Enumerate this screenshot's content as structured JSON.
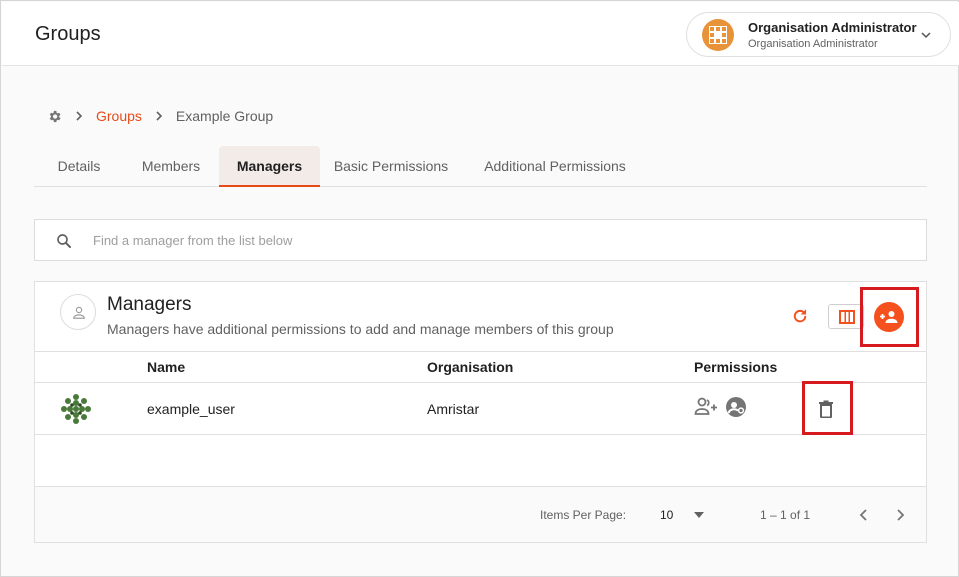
{
  "header": {
    "title": "Groups",
    "user": {
      "name": "Organisation Administrator",
      "role": "Organisation Administrator"
    }
  },
  "breadcrumb": {
    "link": "Groups",
    "current": "Example Group"
  },
  "tabs": [
    {
      "label": "Details",
      "active": false
    },
    {
      "label": "Members",
      "active": false
    },
    {
      "label": "Managers",
      "active": true
    },
    {
      "label": "Basic Permissions",
      "active": false
    },
    {
      "label": "Additional Permissions",
      "active": false
    }
  ],
  "search": {
    "placeholder": "Find a manager from the list below",
    "value": ""
  },
  "card": {
    "title": "Managers",
    "subtitle": "Managers have additional permissions to add and manage members of this group"
  },
  "table": {
    "columns": {
      "name": "Name",
      "organisation": "Organisation",
      "permissions": "Permissions"
    },
    "rows": [
      {
        "name": "example_user",
        "organisation": "Amristar",
        "permission_icons": [
          "add-member-icon",
          "manage-permissions-icon"
        ]
      }
    ]
  },
  "pagination": {
    "items_per_page_label": "Items Per Page:",
    "items_per_page": "10",
    "range": "1 – 1 of 1"
  },
  "colors": {
    "accent": "#e64a19",
    "highlight": "#d71920",
    "tab_active_bg": "#f3ebe8"
  },
  "icons": {
    "header": [
      "org-logo-icon",
      "chevron-down-icon"
    ],
    "breadcrumb": [
      "gear-icon",
      "chevron-right-icon"
    ],
    "search": "search-icon",
    "card": [
      "person-outline-icon",
      "refresh-icon",
      "columns-icon",
      "add-person-icon"
    ],
    "row": [
      "user-avatar-icon",
      "delete-icon"
    ],
    "pagination": [
      "caret-down-icon",
      "chevron-left-icon",
      "chevron-right-icon"
    ]
  }
}
